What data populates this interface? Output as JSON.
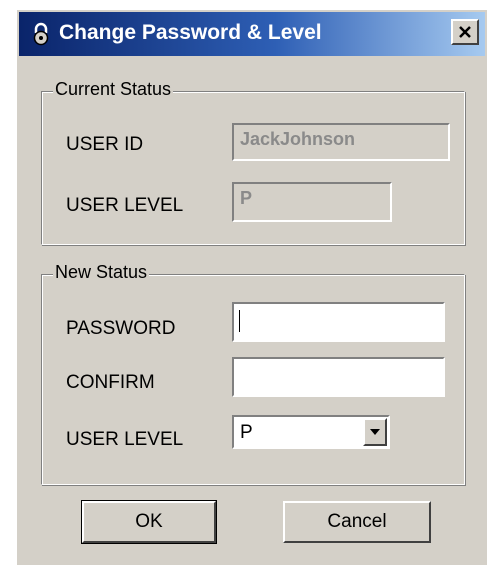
{
  "window": {
    "title": "Change Password & Level",
    "icon": "padlock-icon",
    "close_icon": "close-icon"
  },
  "current_status": {
    "legend": "Current Status",
    "user_id_label": "USER ID",
    "user_id_value": "JackJohnson",
    "user_level_label": "USER LEVEL",
    "user_level_value": "P"
  },
  "new_status": {
    "legend": "New Status",
    "password_label": "PASSWORD",
    "password_value": "",
    "confirm_label": "CONFIRM",
    "confirm_value": "",
    "user_level_label": "USER LEVEL",
    "user_level_selected": "P"
  },
  "buttons": {
    "ok_label": "OK",
    "cancel_label": "Cancel"
  }
}
